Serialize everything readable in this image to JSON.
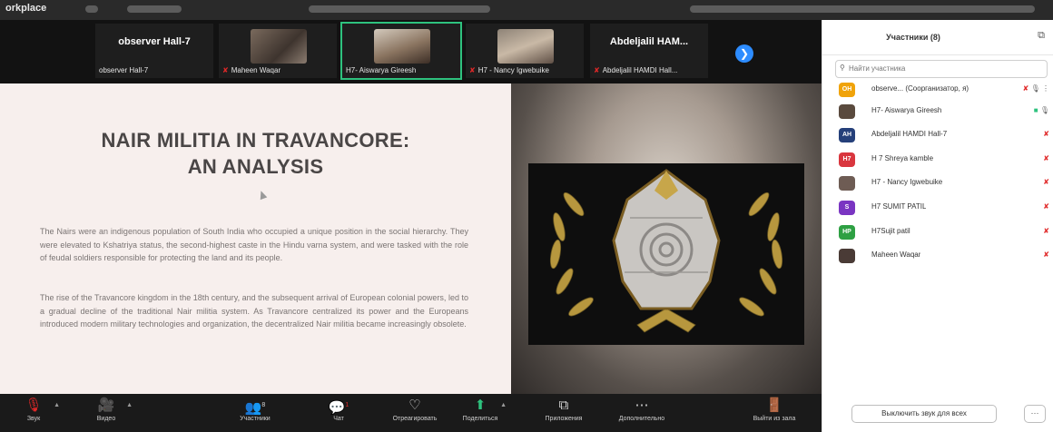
{
  "topbar": {
    "app_name": "orkplace"
  },
  "strip": {
    "tiles": [
      {
        "title": "observer Hall-7",
        "caption": "observer Hall-7"
      },
      {
        "caption": "Maheen Waqar"
      },
      {
        "caption": "H7- Aiswarya Gireesh"
      },
      {
        "caption": "H7 - Nancy Igwebuike"
      },
      {
        "title": "Abdeljalil HAM...",
        "caption": "Abdeljalil HAMDI Hall..."
      }
    ],
    "next_icon": "❯"
  },
  "slide": {
    "title_line1": "NAIR MILITIA IN TRAVANCORE:",
    "title_line2": "AN ANALYSIS",
    "para1": "The Nairs were an indigenous population of South India who occupied a unique position in the social hierarchy. They were elevated to Kshatriya status, the second-highest caste in the Hindu varna system, and were tasked with the role of feudal soldiers responsible for protecting the land and its people.",
    "para2": "The rise of the Travancore kingdom in the 18th century, and the subsequent arrival of European colonial powers, led to a gradual decline of the traditional Nair militia system. As Travancore centralized its power and the Europeans introduced modern military technologies and organization, the decentralized Nair militia became increasingly obsolete."
  },
  "toolbar": {
    "items": [
      {
        "label": "Звук",
        "icon": "🎙"
      },
      {
        "label": "Видео",
        "icon": "🎥"
      },
      {
        "label": "Участники",
        "icon": "👥",
        "badge": "8"
      },
      {
        "label": "Чат",
        "icon": "💬",
        "badge": "1"
      },
      {
        "label": "Отреагировать",
        "icon": "♡"
      },
      {
        "label": "Поделиться",
        "icon": "⬆"
      },
      {
        "label": "Приложения",
        "icon": "⧉"
      },
      {
        "label": "Дополнительно",
        "icon": "⋯"
      },
      {
        "label": "Выйти из зала",
        "icon": "🚪"
      }
    ]
  },
  "participants": {
    "title": "Участники (8)",
    "popout_icon": "⧉",
    "search_placeholder": "Найти участника",
    "list": [
      {
        "initials": "OH",
        "color": "#f0a30a",
        "name": "observe... (Соорганизатор, я)"
      },
      {
        "initials": "",
        "color": "#5a4a3e",
        "name": "H7- Aiswarya Gireesh"
      },
      {
        "initials": "AH",
        "color": "#25407a",
        "name": "Abdeljalil HAMDI Hall-7"
      },
      {
        "initials": "H7",
        "color": "#d9363e",
        "name": "H 7 Shreya kamble"
      },
      {
        "initials": "",
        "color": "#6e5c54",
        "name": "H7 - Nancy Igwebuike"
      },
      {
        "initials": "S",
        "color": "#7a35c2",
        "name": "H7 SUMIT PATIL"
      },
      {
        "initials": "HP",
        "color": "#2ea043",
        "name": "H7Sujit patil"
      },
      {
        "initials": "",
        "color": "#4a3b36",
        "name": "Maheen Waqar"
      }
    ],
    "mute_all_label": "Выключить звук для всех",
    "more_label": "···"
  }
}
